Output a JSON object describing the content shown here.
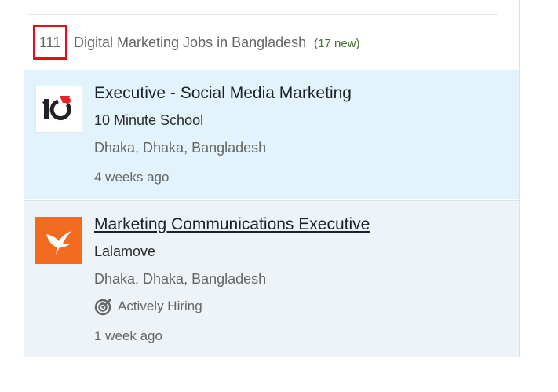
{
  "results": {
    "count": "111",
    "heading": "Digital Marketing Jobs in Bangladesh",
    "new_label": "(17 new)"
  },
  "jobs": [
    {
      "title": "Executive - Social Media Marketing",
      "company": "10 Minute School",
      "location": "Dhaka, Dhaka, Bangladesh",
      "posted": "4 weeks ago",
      "logo_icon": "10-minute-school-logo",
      "highlight_color": "#e3f3fc"
    },
    {
      "title": "Marketing Communications Executive",
      "company": "Lalamove",
      "location": "Dhaka, Dhaka, Bangladesh",
      "badge": "Actively Hiring",
      "badge_icon": "target-icon",
      "posted": "1 week ago",
      "logo_icon": "lalamove-logo",
      "logo_color": "#f26b21"
    }
  ],
  "annotation_color": "#e0111b"
}
